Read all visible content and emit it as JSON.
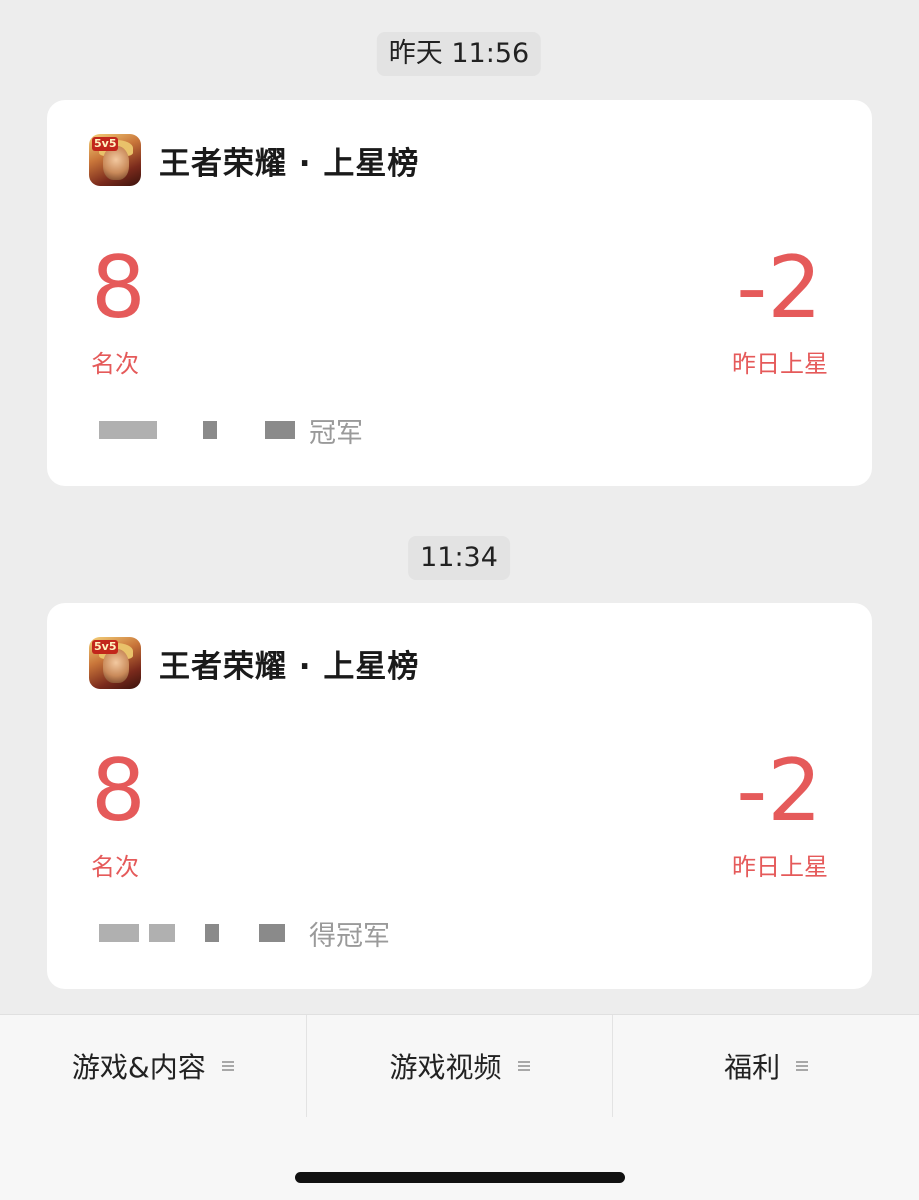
{
  "messages": [
    {
      "timestamp": "昨天 11:56",
      "card": {
        "app_name": "王者荣耀 · 上星榜",
        "app_icon": "king-of-glory-app-icon",
        "left_stat": {
          "value": "8",
          "label": "名次"
        },
        "right_stat": {
          "value": "-2",
          "label": "昨日上星"
        },
        "footer_text": "冠军"
      }
    },
    {
      "timestamp": "11:34",
      "card": {
        "app_name": "王者荣耀 · 上星榜",
        "app_icon": "king-of-glory-app-icon",
        "left_stat": {
          "value": "8",
          "label": "名次"
        },
        "right_stat": {
          "value": "-2",
          "label": "昨日上星"
        },
        "footer_text": "得冠军"
      }
    }
  ],
  "bottom_menu": [
    {
      "label": "游戏&内容",
      "icon": "menu-lines-icon"
    },
    {
      "label": "游戏视频",
      "icon": "menu-lines-icon"
    },
    {
      "label": "福利",
      "icon": "menu-lines-icon"
    }
  ],
  "colors": {
    "background": "#ededed",
    "card": "#ffffff",
    "accent_red": "#e55a5a",
    "muted_text": "#9a9a9a"
  }
}
